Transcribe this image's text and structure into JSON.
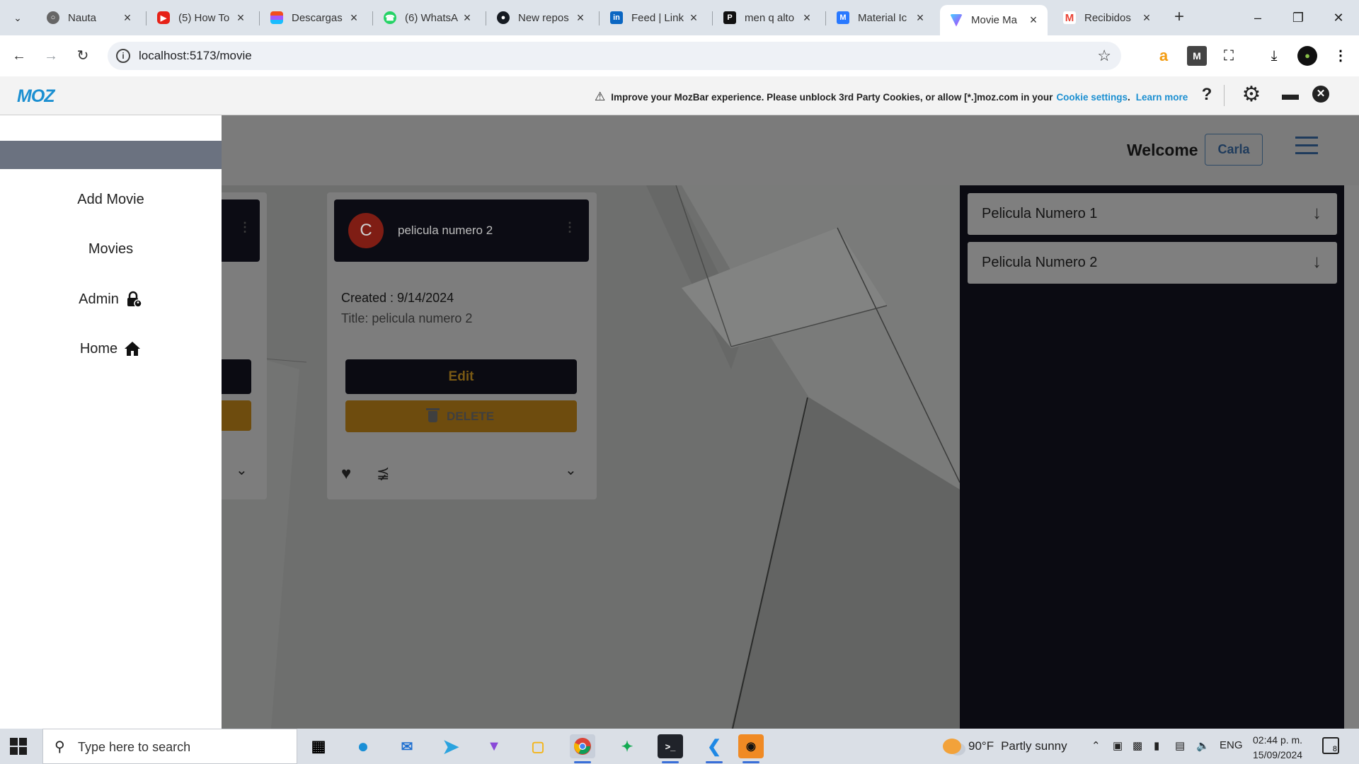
{
  "browser": {
    "tabs": [
      {
        "label": "Nauta",
        "icon": "globe-icon"
      },
      {
        "label": "(5) How To",
        "icon": "youtube-icon"
      },
      {
        "label": "Descargas",
        "icon": "figma-icon"
      },
      {
        "label": "(6) WhatsA",
        "icon": "whatsapp-icon"
      },
      {
        "label": "New repos",
        "icon": "github-icon"
      },
      {
        "label": "Feed | Link",
        "icon": "linkedin-icon"
      },
      {
        "label": "men q alto",
        "icon": "p-icon"
      },
      {
        "label": "Material Ic",
        "icon": "material-icon"
      },
      {
        "label": "Movie Ma",
        "icon": "vite-icon",
        "active": true
      },
      {
        "label": "Recibidos",
        "icon": "gmail-icon"
      }
    ],
    "url": "localhost:5173/movie"
  },
  "mozbar": {
    "logo": "MOZ",
    "message": "Improve your MozBar experience. Please unblock 3rd Party Cookies, or allow [*.]moz.com in your",
    "cookie_link": "Cookie settings",
    "learn_link": "Learn more",
    "help": "?"
  },
  "app": {
    "welcome": "Welcome",
    "user": "Carla",
    "drawer": {
      "items": [
        {
          "label": "Add Movie"
        },
        {
          "label": "Movies"
        },
        {
          "label": "Admin",
          "icon": "lock-icon"
        },
        {
          "label": "Home",
          "icon": "home-icon"
        }
      ]
    },
    "card": {
      "avatar_letter": "C",
      "title": "pelicula numero 2",
      "created": "Created : 9/14/2024",
      "subtitle": "Title: pelicula numero 2",
      "edit_label": "Edit",
      "delete_label": "DELETE"
    },
    "panel": {
      "items": [
        {
          "label": "Pelicula Numero 1"
        },
        {
          "label": "Pelicula Numero 2"
        }
      ]
    }
  },
  "taskbar": {
    "search_placeholder": "Type here to search",
    "weather_temp": "90°F",
    "weather_desc": "Partly sunny",
    "lang": "ENG",
    "time": "02:44 p. m.",
    "date": "15/09/2024",
    "notif_count": "8"
  },
  "colors": {
    "accent": "#1b8fd1",
    "edit_text": "#f0a500",
    "delete_bg": "#e0a020",
    "avatar_bg": "#d32f2f"
  }
}
